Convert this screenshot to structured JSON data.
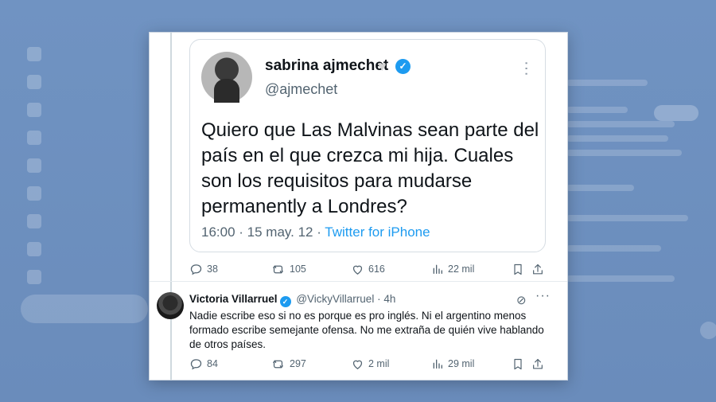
{
  "quoted_tweet": {
    "author_name": "sabrina ajmechet",
    "handle": "@ajmechet",
    "text": "Quiero que Las Malvinas sean parte del país en el que crezca mi hija. Cuales son los requisitos para mudarse permanently a Londres?",
    "time": "16:00 · 15 may. 12 · ",
    "source": "Twitter for iPhone",
    "icons": {
      "verified": "verified-badge-icon",
      "heart": "heart-icon",
      "more": "more-vertical-icon"
    }
  },
  "quoted_actions": {
    "replies": "38",
    "retweets": "105",
    "likes": "616",
    "views": "22 mil"
  },
  "reply_tweet": {
    "author_name": "Victoria Villarruel",
    "handle": "@VickyVillarruel",
    "time": "· 4h",
    "text": "Nadie escribe eso si no es porque es pro inglés. Ni el argentino menos formado escribe semejante ofensa. No me extraña de quién vive hablando de otros países.",
    "icons": {
      "verified": "verified-badge-icon",
      "grok": "grok-icon",
      "more": "more-horizontal-icon"
    }
  },
  "reply_actions": {
    "replies": "84",
    "retweets": "297",
    "likes": "2 mil",
    "views": "29 mil"
  },
  "colors": {
    "accent": "#1d9bf0",
    "muted_text": "#536471",
    "backdrop": "#6d8fbd"
  }
}
